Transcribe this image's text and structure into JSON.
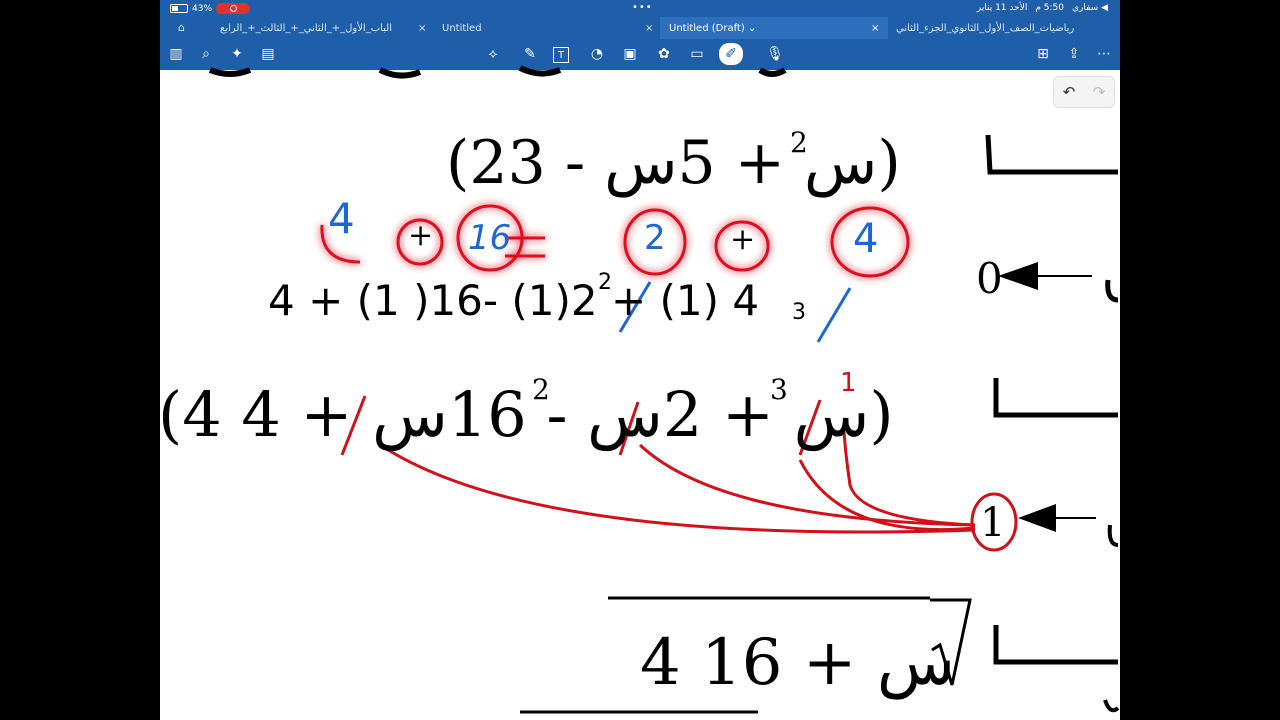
{
  "status": {
    "battery": "43%",
    "time": "5:50 م",
    "date": "الأحد 11 يناير",
    "back_app": "◀ سفاري"
  },
  "tabs": [
    {
      "label": "الباب_الأول_+_الثاني_+_الثالث_+_الرابع"
    },
    {
      "label": "Untitled"
    },
    {
      "label": "Untitled (Draft) ⌄"
    },
    {
      "label": "رياضيات_الصف_الأول_الثانوي_الجزء_الثاني"
    }
  ],
  "icons": {
    "home": "⌂",
    "close": "×",
    "sidebar": "▥",
    "search": "⌕",
    "sparkle": "✦",
    "clipboard": "▤",
    "lasso": "⟡",
    "pen": "✎",
    "text": "T",
    "shapes": "◔",
    "image": "▣",
    "sticker": "✿",
    "comment": "▭",
    "eraser": "✐",
    "mic": "🎙",
    "add_page": "⊞",
    "share": "⇪",
    "more": "⋯",
    "undo": "↶",
    "redo": "↷"
  },
  "content": {
    "line1": {
      "expr": "(2س + 5س - 3)",
      "exp": "2",
      "annotations": {
        "a": "4",
        "b": "2",
        "c": "16",
        "d": "4",
        "plus1": "+",
        "plus2": "+"
      }
    },
    "line2": {
      "expr": "4 + (1 )16- (1)2 + (1) 4",
      "exp1": "2",
      "exp2": "3",
      "arrow_value": "0"
    },
    "line3": {
      "expr": "(4 س + 2س - 16س + 4)",
      "exp1": "3",
      "exp2": "2",
      "arrow_value": "1",
      "tick": "1"
    },
    "line4": {
      "expr": "4 س + 16"
    }
  },
  "colors": {
    "toolbar": "#1f5ea8",
    "red_ink": "#d3101a",
    "blue_ink": "#1e66d0"
  }
}
